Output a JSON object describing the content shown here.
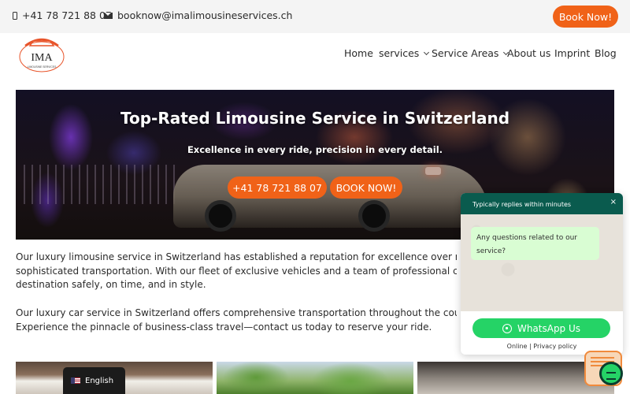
{
  "topbar": {
    "phone": "+41 78 721 88 07",
    "email": "booknow@imalimousineservices.ch",
    "book_label": "Book Now!",
    "accent": "#f06218"
  },
  "logo": {
    "text": "IMA",
    "subtext": "LIMOUSINE SERVICES"
  },
  "nav": {
    "items": [
      {
        "label": "Home"
      },
      {
        "label": "services"
      },
      {
        "label": "Service Areas"
      },
      {
        "label": "About us"
      },
      {
        "label": "Imprint"
      },
      {
        "label": "Blog"
      }
    ]
  },
  "hero": {
    "title": "Top-Rated Limousine Service in Switzerland",
    "subtitle": "Excellence in every ride, precision in every detail.",
    "phone_button": "+41 78 721 88 07",
    "book_button": "BOOK NOW!"
  },
  "content": {
    "p1_lines": [
      "Our luxury limousine service in Switzerland has established a reputation for excellence over many years,",
      "sophisticated transportation. With our fleet of exclusive vehicles and a team of professional chauffeurs, we",
      "destination safely, on time, and in style."
    ],
    "p2_lines": [
      "Our luxury car service in Switzerland offers comprehensive transportation throughout the country, including",
      "Experience the pinnacle of business-class travel—contact us today to reserve your ride."
    ]
  },
  "language": {
    "label": "English"
  },
  "whatsapp": {
    "header": "Typically replies within minutes",
    "close": "×",
    "message": "Any questions related to our service?",
    "button": "WhatsApp Us",
    "online": "Online",
    "separator": "|",
    "privacy": "Privacy policy",
    "color": "#25d366",
    "header_color": "#0a5b4e"
  }
}
